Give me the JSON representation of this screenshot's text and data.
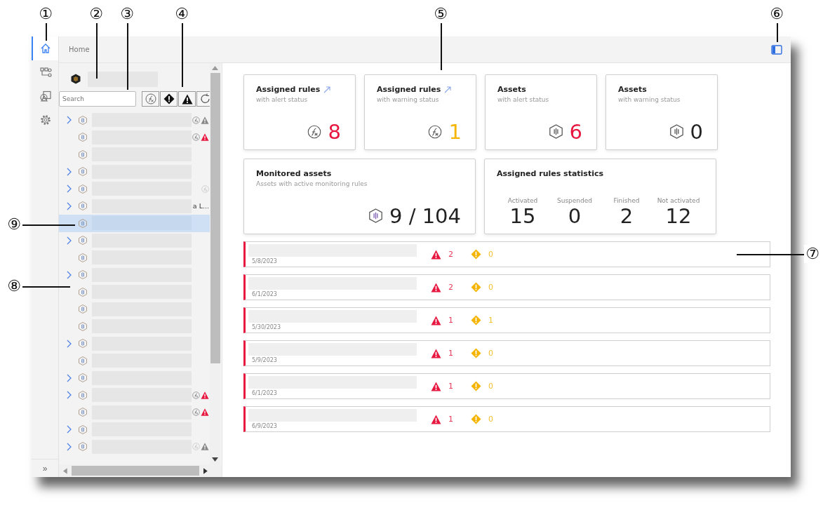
{
  "nav": {
    "items": [
      {
        "kind": "home",
        "selected": true
      },
      {
        "kind": "nodes",
        "selected": false
      },
      {
        "kind": "shapes",
        "selected": false
      },
      {
        "kind": "settings",
        "selected": false
      }
    ],
    "expand_label": "»"
  },
  "breadcrumb": "Home",
  "tree": {
    "search": {
      "placeholder": "Search"
    },
    "filters": [
      {
        "kind": "rule"
      },
      {
        "kind": "warning"
      },
      {
        "kind": "alert"
      },
      {
        "kind": "refresh"
      }
    ],
    "items": [
      {
        "kind": "group",
        "selected": false,
        "rule_icon": true,
        "rule_enabled": true,
        "warning_icon": true,
        "critical": false
      },
      {
        "kind": "leaf",
        "selected": false,
        "rule_icon": true,
        "rule_enabled": true,
        "warning_icon": true,
        "critical": true
      },
      {
        "kind": "leaf",
        "selected": false
      },
      {
        "kind": "group",
        "selected": false
      },
      {
        "kind": "group",
        "selected": false,
        "rule_icon": true,
        "rule_enabled": false
      },
      {
        "kind": "group",
        "selected": false,
        "label": "a L..."
      },
      {
        "kind": "leaf",
        "selected": true
      },
      {
        "kind": "group",
        "selected": false
      },
      {
        "kind": "leaf",
        "selected": false
      },
      {
        "kind": "group",
        "selected": false
      },
      {
        "kind": "leaf",
        "selected": false
      },
      {
        "kind": "leaf",
        "selected": false
      },
      {
        "kind": "leaf",
        "selected": false
      },
      {
        "kind": "group",
        "selected": false
      },
      {
        "kind": "leaf",
        "selected": false
      },
      {
        "kind": "group",
        "selected": false
      },
      {
        "kind": "group",
        "selected": false,
        "rule_icon": true,
        "rule_enabled": true,
        "warning_icon": true,
        "critical": true
      },
      {
        "kind": "leaf",
        "selected": false,
        "rule_icon": true,
        "rule_enabled": true,
        "warning_icon": true,
        "critical": true
      },
      {
        "kind": "group",
        "selected": false
      },
      {
        "kind": "group",
        "selected": false,
        "rule_icon": true,
        "rule_enabled": false,
        "warning_icon": true,
        "critical": false
      }
    ]
  },
  "summary_cards": [
    {
      "kind": "rule",
      "title": "Assigned rules",
      "subtitle": "with alert status",
      "link": true,
      "value": "8",
      "color": "#e8173f"
    },
    {
      "kind": "rule",
      "title": "Assigned rules",
      "subtitle": "with warning status",
      "link": true,
      "value": "1",
      "color": "#f5b400"
    },
    {
      "kind": "asset",
      "title": "Assets",
      "subtitle": "with alert status",
      "link": false,
      "value": "6",
      "color": "#e8173f"
    },
    {
      "kind": "asset",
      "title": "Assets",
      "subtitle": "with warning status",
      "link": false,
      "value": "0",
      "color": "#222222"
    }
  ],
  "monitored": {
    "title": "Monitored assets",
    "subtitle": "Assets with active monitoring rules",
    "value": "9 / 104"
  },
  "statistics": {
    "title": "Assigned rules statistics",
    "items": [
      {
        "label": "Activated",
        "value": "15"
      },
      {
        "label": "Suspended",
        "value": "0"
      },
      {
        "label": "Finished",
        "value": "2"
      },
      {
        "label": "Not activated",
        "value": "12"
      }
    ]
  },
  "alerts": [
    {
      "critical": true,
      "date": "5/8/2023",
      "alert_count": "2",
      "warning_count": "0"
    },
    {
      "critical": true,
      "date": "6/1/2023",
      "alert_count": "2",
      "warning_count": "0"
    },
    {
      "critical": true,
      "date": "5/30/2023",
      "alert_count": "1",
      "warning_count": "1"
    },
    {
      "critical": true,
      "date": "5/9/2023",
      "alert_count": "1",
      "warning_count": "0"
    },
    {
      "critical": true,
      "date": "6/1/2023",
      "alert_count": "1",
      "warning_count": "0"
    },
    {
      "critical": true,
      "date": "6/9/2023",
      "alert_count": "1",
      "warning_count": "0"
    }
  ],
  "callouts": [
    "①",
    "②",
    "③",
    "④",
    "⑤",
    "⑥",
    "⑦",
    "⑧",
    "⑨"
  ]
}
